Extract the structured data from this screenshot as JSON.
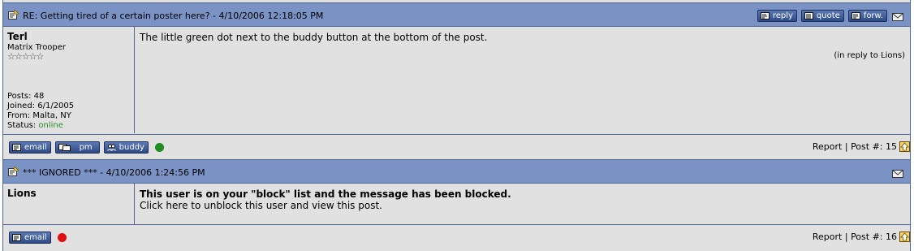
{
  "posts": [
    {
      "subject": "RE: Getting tired of a certain poster here? - 4/10/2006 12:18:05 PM",
      "header_buttons": {
        "reply": "reply",
        "quote": "quote",
        "forward": "forw."
      },
      "author": {
        "name": "Terl",
        "rank": "Matrix Trooper",
        "stars": "☆☆☆☆☆",
        "posts": "Posts: 48",
        "joined": "Joined: 6/1/2005",
        "from": "From: Malta, NY",
        "status_label": "Status: ",
        "status_value": "online"
      },
      "body": "The little green dot next to the buddy button at the bottom of the post.",
      "reply_to": "(in reply to Lions)",
      "footer_buttons": {
        "email": "email",
        "pm": "pm",
        "buddy": "buddy"
      },
      "status_dot_color": "#1e8c1e",
      "report": "Report",
      "separator": "|",
      "post_number": "Post #: 15"
    },
    {
      "subject": "*** IGNORED *** - 4/10/2006 1:24:56 PM",
      "author": {
        "name": "Lions"
      },
      "body_blocked": "This user is on your \"block\" list and the message has been blocked.",
      "body_unblock": "Click here to unblock this user and view this post.",
      "footer_buttons": {
        "email": "email"
      },
      "status_dot_color": "#e01010",
      "report": "Report",
      "separator": "|",
      "post_number": "Post #: 16"
    }
  ],
  "colors": {
    "header_bg": "#7a93c4",
    "border": "#4f6898",
    "body_bg": "#e1e1e1",
    "button_bg": "#2e4b86"
  }
}
